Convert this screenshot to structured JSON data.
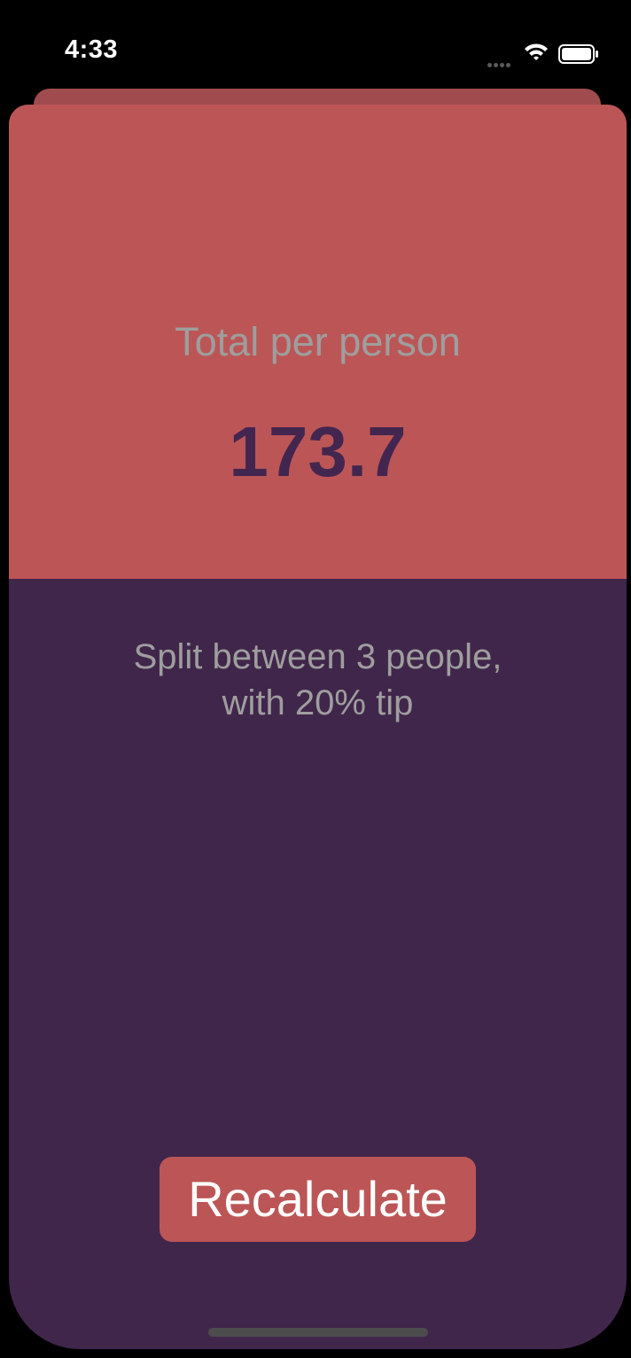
{
  "status_bar": {
    "time": "4:33",
    "icons": [
      "signal-icon",
      "wifi-icon",
      "battery-icon"
    ]
  },
  "result": {
    "total_label": "Total per person",
    "total_value": "173.7",
    "split_line1": "Split between 3  people,",
    "split_line2": "with 20% tip"
  },
  "actions": {
    "recalculate_label": "Recalculate"
  },
  "colors": {
    "accent": "#bc5656",
    "background": "#41264b",
    "label_gray": "#9e9e9e",
    "value_purple": "#432650"
  }
}
